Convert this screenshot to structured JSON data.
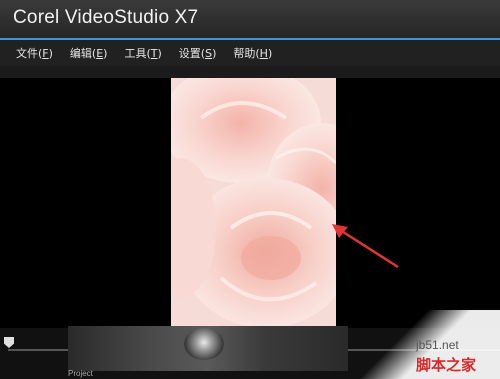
{
  "window": {
    "title": "Corel VideoStudio X7"
  },
  "menu": [
    {
      "label": "文件(",
      "key": "F",
      "suffix": ")"
    },
    {
      "label": "编辑(",
      "key": "E",
      "suffix": ")"
    },
    {
      "label": "工具(",
      "key": "T",
      "suffix": ")"
    },
    {
      "label": "设置(",
      "key": "S",
      "suffix": ")"
    },
    {
      "label": "帮助(",
      "key": "H",
      "suffix": ")"
    }
  ],
  "timeline": {
    "label": "Project"
  },
  "watermark": {
    "site": "jb51.net",
    "text": "脚本之家"
  },
  "colors": {
    "accent": "#3a98d8",
    "arrow": "#e03535",
    "watermark": "#d42b2b"
  }
}
